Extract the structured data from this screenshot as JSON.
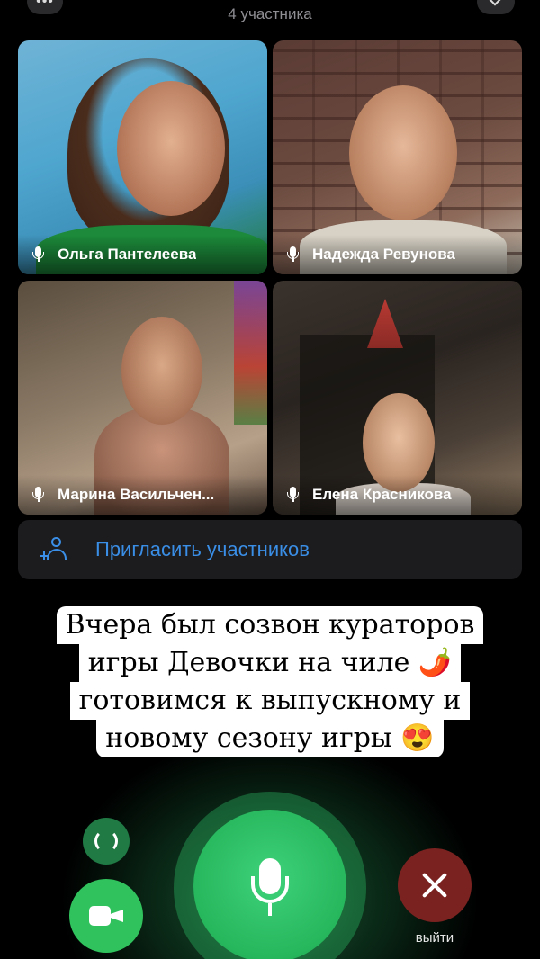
{
  "header": {
    "participants_count": "4 участника",
    "menu_icon": "more-dots-icon",
    "minimize_icon": "chevron-down-icon"
  },
  "participants": [
    {
      "name": "Ольга Пантелеева",
      "mic_icon": "microphone-icon"
    },
    {
      "name": "Надежда Ревунова",
      "mic_icon": "microphone-icon"
    },
    {
      "name": "Марина Васильчен...",
      "mic_icon": "microphone-icon"
    },
    {
      "name": "Елена Красникова",
      "mic_icon": "microphone-icon"
    }
  ],
  "invite": {
    "label": "Пригласить участников",
    "icon": "add-person-icon"
  },
  "caption": {
    "lines": [
      "Вчера был созвон кураторов",
      "игры Девочки на чиле 🌶️",
      "готовимся к выпускному и",
      "новому сезону игры 😍"
    ]
  },
  "controls": {
    "flip_icon": "flip-camera-icon",
    "video_icon": "video-camera-icon",
    "mic_icon": "microphone-icon",
    "leave_icon": "close-icon",
    "leave_label": "выйти"
  },
  "colors": {
    "accent_blue": "#3a8ee6",
    "green": "#30c25c",
    "leave_red": "#7a2220",
    "panel": "#1c1c1e"
  }
}
